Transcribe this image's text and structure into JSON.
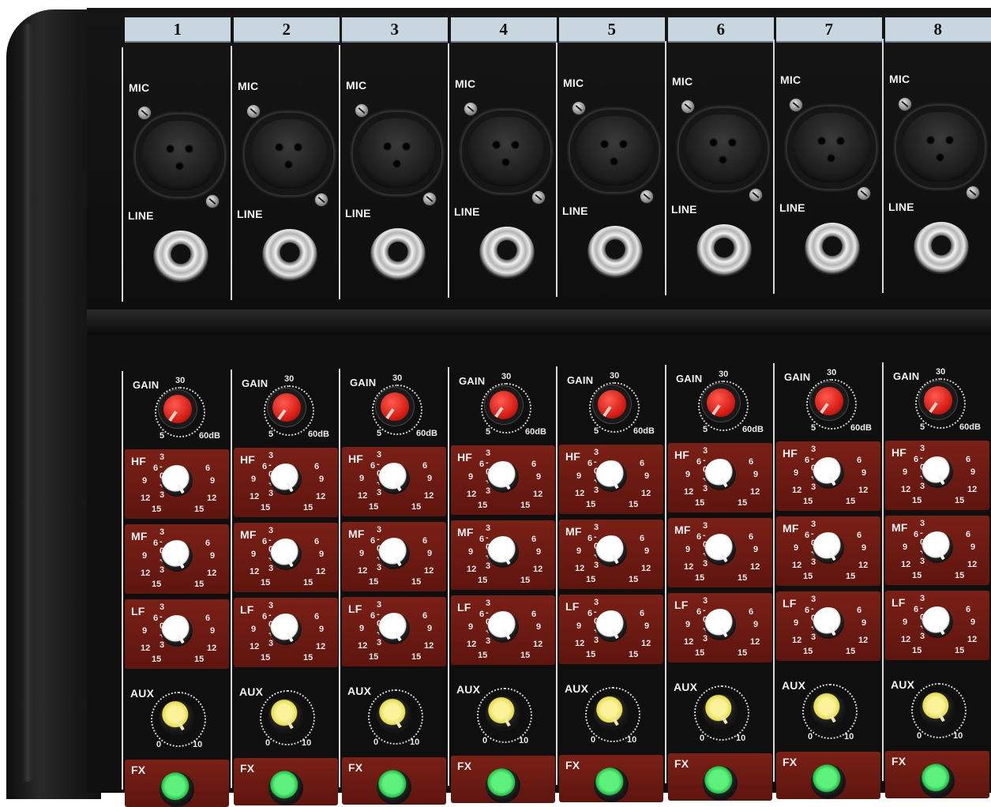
{
  "channels": [
    {
      "number": "1"
    },
    {
      "number": "2"
    },
    {
      "number": "3"
    },
    {
      "number": "4"
    },
    {
      "number": "5"
    },
    {
      "number": "6"
    },
    {
      "number": "7"
    },
    {
      "number": "8"
    }
  ],
  "labels": {
    "mic": "MIC",
    "line": "LINE",
    "gain": "GAIN",
    "gain_top": "30",
    "gain_min": "5",
    "gain_max": "60dB",
    "hf": "HF",
    "mf": "MF",
    "lf": "LF",
    "eq_scale": "3 - 0 + 3",
    "eq_6": "6",
    "eq_9": "9",
    "eq_12": "12",
    "eq_15": "15",
    "aux": "AUX",
    "aux_min": "0",
    "aux_max": "10",
    "fx": "FX"
  },
  "colors": {
    "panel": "#0f0f0f",
    "header_strip": "#c8d6df",
    "eq_block": "#6a1a12",
    "gain_knob": "#d21a12",
    "eq_knob": "#ffffff",
    "aux_knob": "#e6dc4a",
    "fx_knob": "#1fbe45"
  }
}
